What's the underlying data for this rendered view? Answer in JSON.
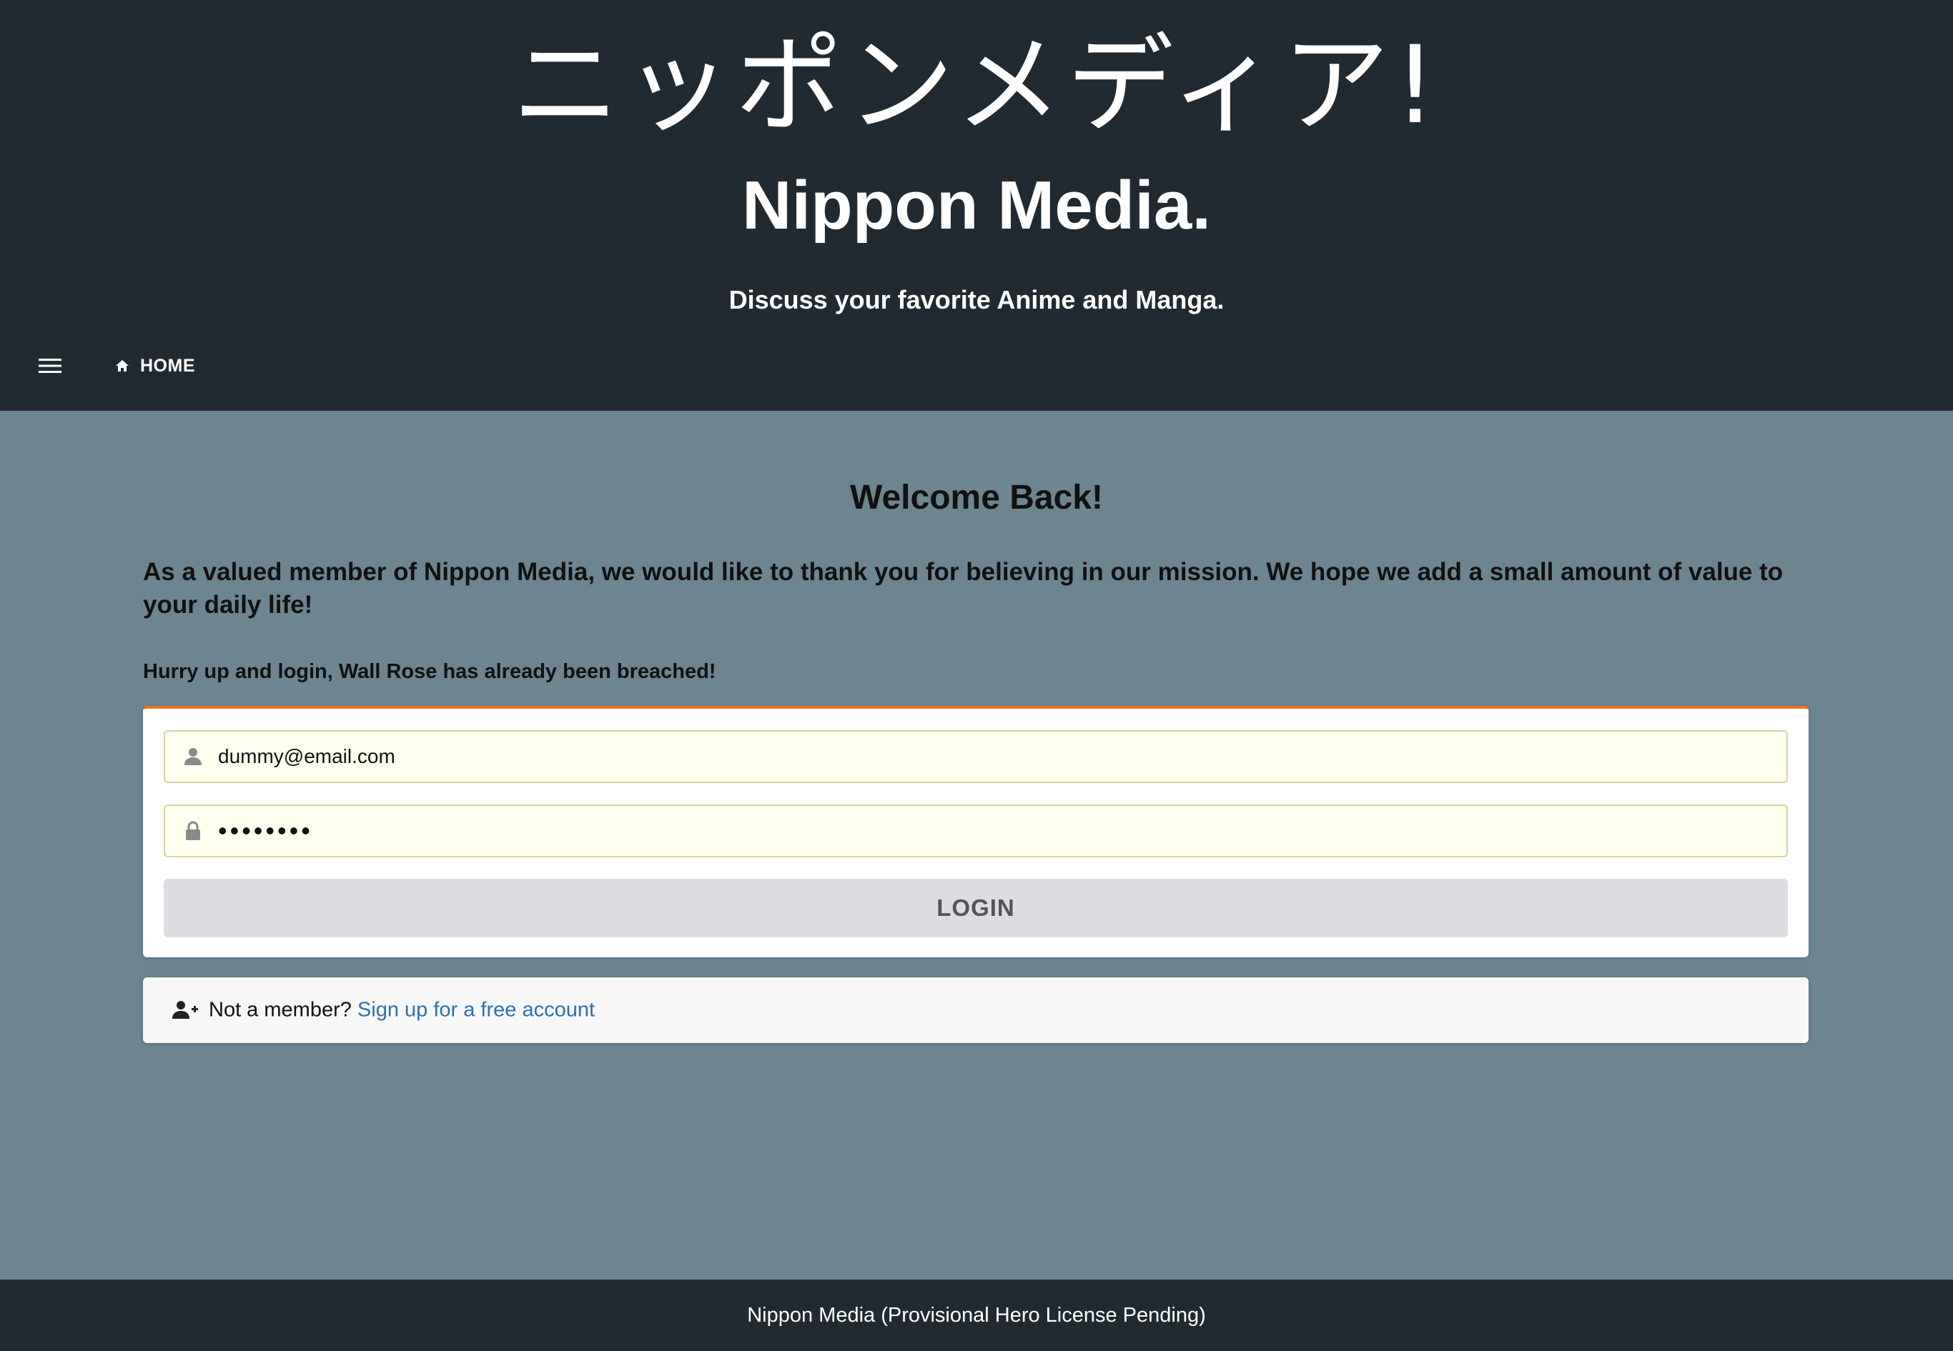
{
  "header": {
    "jp_title": "ニッポンメディア!",
    "en_title": "Nippon Media.",
    "tagline": "Discuss your favorite Anime and Manga.",
    "nav": {
      "menu_icon": "hamburger-menu-icon",
      "home_icon": "home-icon",
      "home_label": "HOME"
    }
  },
  "main": {
    "welcome": "Welcome Back!",
    "intro": "As a valued member of Nippon Media, we would like to thank you for believing in our mission. We hope we add a small amount of value to your daily life!",
    "hurry": "Hurry up and login, Wall Rose has already been breached!",
    "login_form": {
      "email_icon": "user-icon",
      "email_value": "dummy@email.com",
      "password_icon": "lock-icon",
      "password_value": "••••••••",
      "login_label": "LOGIN"
    },
    "signup": {
      "icon": "user-plus-icon",
      "prompt": "Not a member?",
      "link_label": "Sign up for a free account"
    }
  },
  "footer": {
    "text": "Nippon Media (Provisional Hero License Pending)"
  },
  "colors": {
    "header_bg": "#222a31",
    "page_bg": "#6d8591",
    "accent_top_border": "#f2711c",
    "input_bg": "#fffff0",
    "link": "#2e6fb5",
    "button_bg": "#dcdde0"
  }
}
